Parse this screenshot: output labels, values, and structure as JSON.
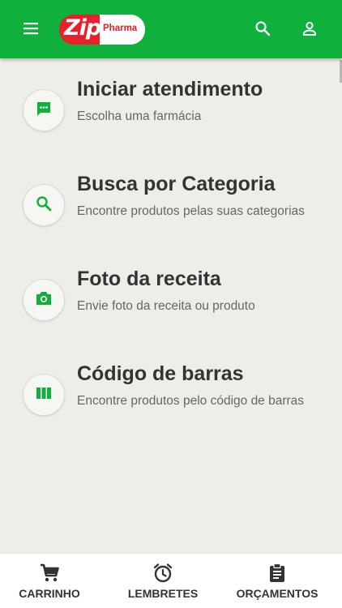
{
  "header": {
    "logo": {
      "brand": "Zip",
      "sub": "Pharma"
    },
    "menu_icon": "menu-icon",
    "search_icon": "search-icon",
    "user_icon": "user-icon",
    "bg_color": "#10b03c"
  },
  "menu": {
    "items": [
      {
        "icon": "chat-icon",
        "title": "Iniciar atendimento",
        "subtitle": "Escolha uma farmácia"
      },
      {
        "icon": "search-icon",
        "title": "Busca por Categoria",
        "subtitle": "Encontre produtos pelas suas categorias"
      },
      {
        "icon": "camera-icon",
        "title": "Foto da receita",
        "subtitle": "Envie foto da receita ou produto"
      },
      {
        "icon": "barcode-icon",
        "title": "Código de barras",
        "subtitle": "Encontre produtos pelo código de barras"
      }
    ],
    "icon_color": "#10b03c"
  },
  "bottom_nav": {
    "tabs": [
      {
        "icon": "cart-icon",
        "label": "CARRINHO"
      },
      {
        "icon": "alarm-icon",
        "label": "LEMBRETES"
      },
      {
        "icon": "clipboard-icon",
        "label": "ORÇAMENTOS"
      }
    ]
  }
}
